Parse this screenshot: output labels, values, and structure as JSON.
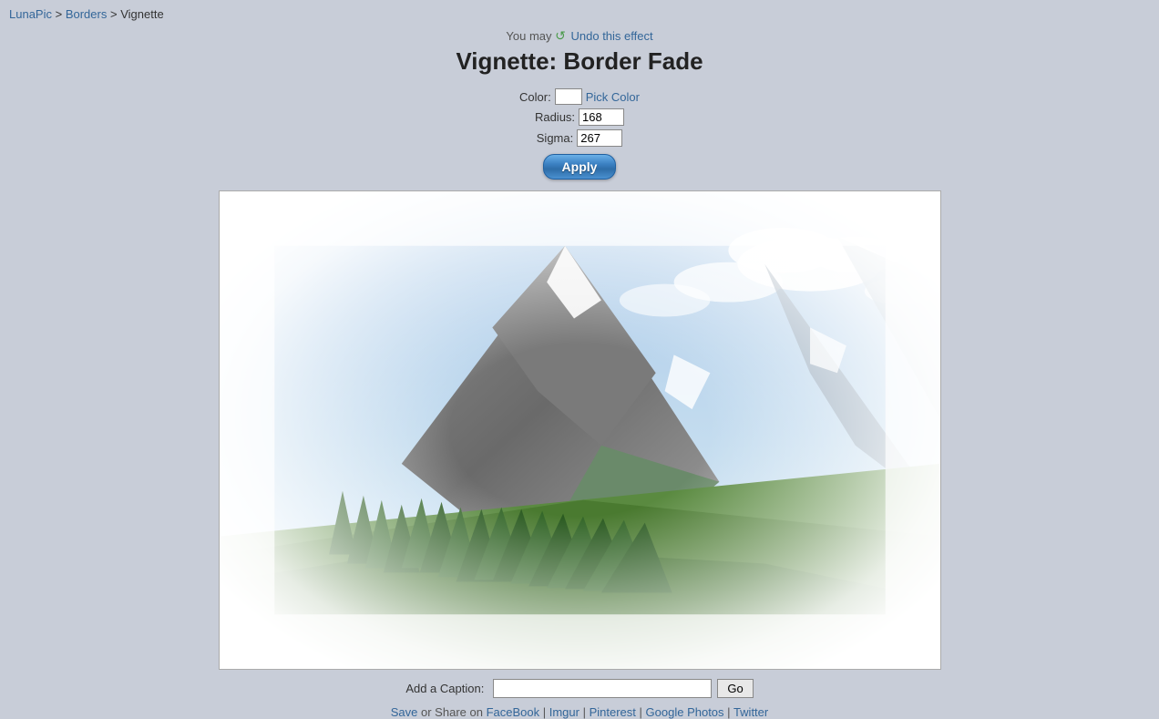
{
  "breadcrumb": {
    "lunapic_label": "LunaPic",
    "lunapic_href": "#",
    "borders_label": "Borders",
    "borders_href": "#",
    "current_label": "Vignette"
  },
  "header": {
    "undo_prefix": "You may",
    "undo_label": "Undo this effect",
    "title": "Vignette: Border Fade"
  },
  "controls": {
    "color_label": "Color:",
    "pick_color_label": "Pick Color",
    "radius_label": "Radius:",
    "radius_value": "168",
    "sigma_label": "Sigma:",
    "sigma_value": "267",
    "apply_label": "Apply"
  },
  "caption": {
    "label": "Add a Caption:",
    "placeholder": "",
    "go_label": "Go"
  },
  "footer": {
    "save_label": "Save",
    "share_prefix": "or Share on",
    "facebook_label": "FaceBook",
    "imgur_label": "Imgur",
    "pinterest_label": "Pinterest",
    "google_photos_label": "Google Photos",
    "twitter_label": "Twitter"
  }
}
